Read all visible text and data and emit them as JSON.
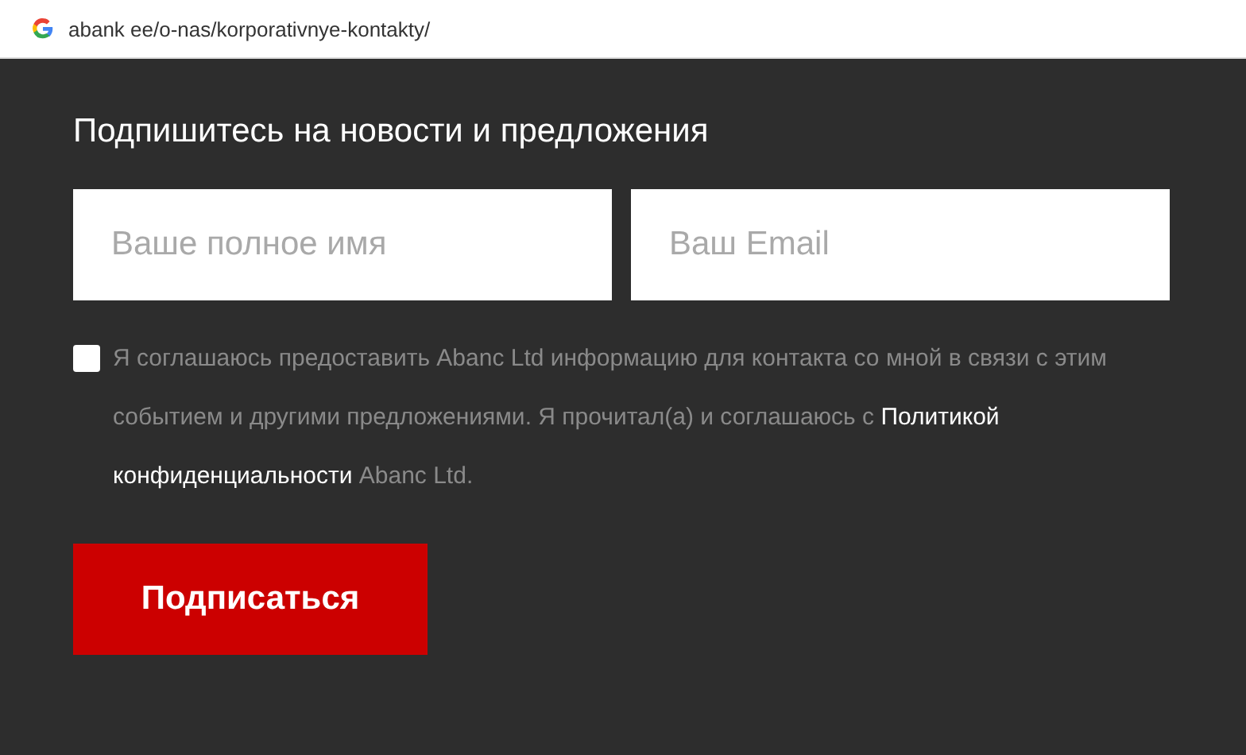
{
  "address_bar": {
    "url": "abank ee/o-nas/korporativnye-kontakty/"
  },
  "subscribe": {
    "title": "Подпишитесь на новости и предложения",
    "fields": [
      {
        "placeholder": "Ваше полное имя"
      },
      {
        "placeholder": "Ваш Email"
      }
    ],
    "consent": {
      "checked": false,
      "text": "Я соглашаюсь предоставить Abanc Ltd информацию для контакта со мной в связи с этим событием и другими предложениями. Я прочитал(а) и соглашаюсь с **Политикой конфиденциальности** Abanc Ltd."
    },
    "button": "Подписаться"
  }
}
